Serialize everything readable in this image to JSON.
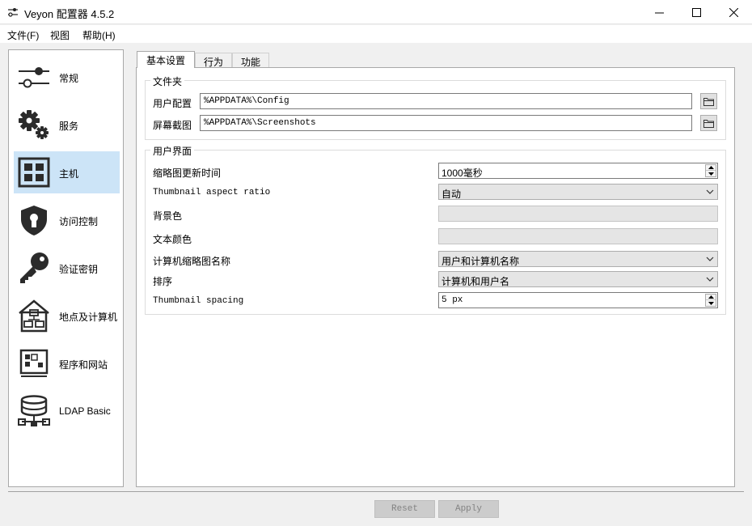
{
  "window": {
    "title": "Veyon 配置器 4.5.2"
  },
  "menu": [
    {
      "label": "文件(F)"
    },
    {
      "label": "视图"
    },
    {
      "label": "帮助(H)"
    }
  ],
  "sidebar": {
    "items": [
      {
        "label": "常规",
        "icon": "toggle-icon"
      },
      {
        "label": "服务",
        "icon": "gears-icon"
      },
      {
        "label": "主机",
        "icon": "grid-icon",
        "active": true
      },
      {
        "label": "访问控制",
        "icon": "shield-lock-icon"
      },
      {
        "label": "验证密钥",
        "icon": "key-icon"
      },
      {
        "label": "地点及计算机",
        "icon": "house-computers-icon"
      },
      {
        "label": "程序和网站",
        "icon": "programs-icon"
      },
      {
        "label": "LDAP Basic",
        "icon": "database-network-icon"
      }
    ]
  },
  "tabs": [
    {
      "label": "基本设置",
      "active": true
    },
    {
      "label": "行为"
    },
    {
      "label": "功能"
    }
  ],
  "folders": {
    "title": "文件夹",
    "user_config": {
      "label": "用户配置",
      "value": "%APPDATA%\\Config"
    },
    "screenshots": {
      "label": "屏幕截图",
      "value": "%APPDATA%\\Screenshots"
    }
  },
  "ui": {
    "title": "用户界面",
    "thumbnail_update": {
      "label": "缩略图更新时间",
      "value": "1000毫秒"
    },
    "aspect_ratio": {
      "label": "Thumbnail aspect ratio",
      "value": "自动"
    },
    "background_color": {
      "label": "背景色"
    },
    "text_color": {
      "label": "文本颜色"
    },
    "thumbnail_caption": {
      "label": "计算机缩略图名称",
      "value": "用户和计算机名称"
    },
    "sort_order": {
      "label": "排序",
      "value": "计算机和用户名"
    },
    "thumbnail_spacing": {
      "label": "Thumbnail spacing",
      "value": "5 px"
    }
  },
  "footer": {
    "reset_label": "Reset",
    "apply_label": "Apply"
  },
  "colors": {
    "active_nav": "#cce4f7",
    "icon_dark": "#2b2b2b",
    "disabled_button_text": "#838383"
  }
}
